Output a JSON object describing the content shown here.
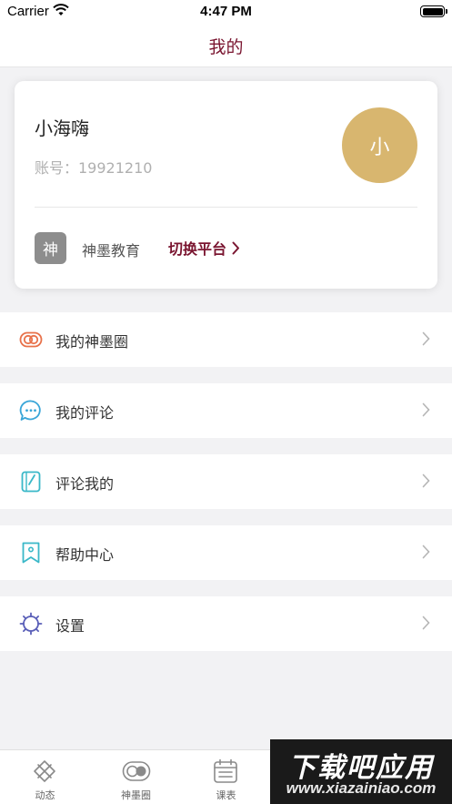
{
  "status_bar": {
    "carrier": "Carrier",
    "time": "4:47 PM"
  },
  "nav": {
    "title": "我的"
  },
  "profile": {
    "name": "小海嗨",
    "account": "账号：19921210",
    "avatar_text": "小",
    "org_icon_text": "神",
    "org_name": "神墨教育",
    "switch_label": "切换平台"
  },
  "menu": [
    {
      "label": "我的神墨圈",
      "icon": "shenmo-circle-icon",
      "color": "#e8714a"
    },
    {
      "label": "我的评论",
      "icon": "chat-bubble-icon",
      "color": "#3aa6d8"
    },
    {
      "label": "评论我的",
      "icon": "note-pen-icon",
      "color": "#3ab8c8"
    },
    {
      "label": "帮助中心",
      "icon": "bookmark-person-icon",
      "color": "#3ab8c8"
    },
    {
      "label": "设置",
      "icon": "gear-icon",
      "color": "#5a5fb8"
    }
  ],
  "tabs": [
    {
      "label": "动态",
      "icon": "compass-icon"
    },
    {
      "label": "神墨圈",
      "icon": "toggle-circle-icon"
    },
    {
      "label": "课表",
      "icon": "calendar-icon"
    }
  ],
  "watermark": {
    "top": "下载吧应用",
    "bottom": "www.xiazainiao.com"
  },
  "colors": {
    "accent": "#7a1530",
    "avatar_bg": "#d8b66f",
    "org_icon_bg": "#8d8d8d"
  }
}
